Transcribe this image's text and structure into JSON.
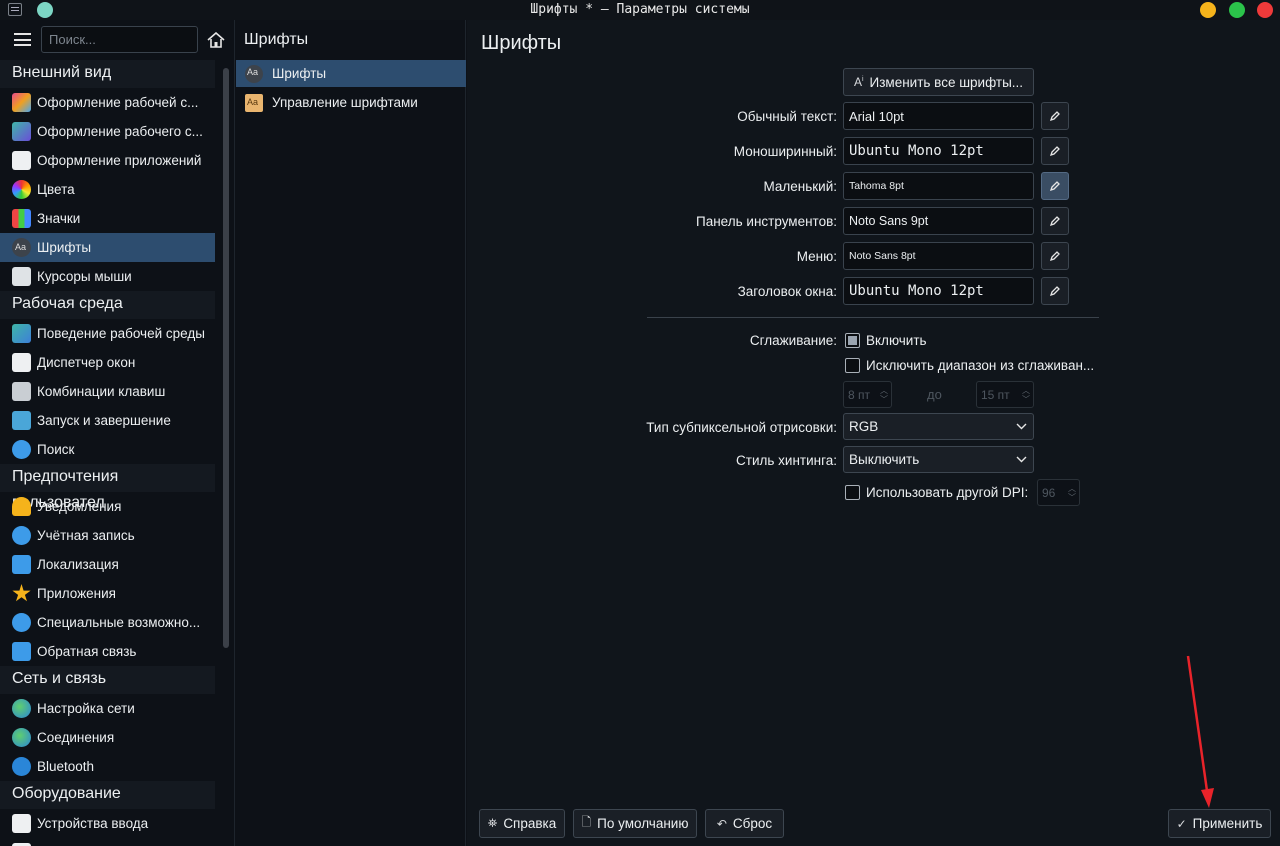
{
  "window": {
    "title": "Шрифты * — Параметры системы"
  },
  "sidebar": {
    "search_placeholder": "Поиск...",
    "categories": [
      {
        "header": "Внешний вид",
        "items": [
          {
            "label": "Оформление рабочей с...",
            "icon": "global-theme-icon"
          },
          {
            "label": "Оформление рабочего с...",
            "icon": "plasma-style-icon"
          },
          {
            "label": "Оформление приложений",
            "icon": "app-style-icon"
          },
          {
            "label": "Цвета",
            "icon": "colors-icon"
          },
          {
            "label": "Значки",
            "icon": "icons-icon"
          },
          {
            "label": "Шрифты",
            "icon": "fonts-icon",
            "active": true
          },
          {
            "label": "Курсоры мыши",
            "icon": "cursor-icon"
          }
        ]
      },
      {
        "header": "Рабочая среда",
        "items": [
          {
            "label": "Поведение рабочей среды",
            "icon": "workspace-icon"
          },
          {
            "label": "Диспетчер окон",
            "icon": "window-manager-icon"
          },
          {
            "label": "Комбинации клавиш",
            "icon": "keyboard-icon"
          },
          {
            "label": "Запуск и завершение",
            "icon": "startup-icon"
          },
          {
            "label": "Поиск",
            "icon": "search-icon"
          }
        ]
      },
      {
        "header": "Предпочтения пользовател",
        "items": [
          {
            "label": "Уведомления",
            "icon": "bell-icon"
          },
          {
            "label": "Учётная запись",
            "icon": "user-icon"
          },
          {
            "label": "Локализация",
            "icon": "locale-icon"
          },
          {
            "label": "Приложения",
            "icon": "star-icon"
          },
          {
            "label": "Специальные возможно...",
            "icon": "accessibility-icon"
          },
          {
            "label": "Обратная связь",
            "icon": "feedback-icon"
          }
        ]
      },
      {
        "header": "Сеть и связь",
        "items": [
          {
            "label": "Настройка сети",
            "icon": "globe-icon"
          },
          {
            "label": "Соединения",
            "icon": "globe-icon"
          },
          {
            "label": "Bluetooth",
            "icon": "bluetooth-icon"
          }
        ]
      },
      {
        "header": "Оборудование",
        "items": [
          {
            "label": "Устройства ввода",
            "icon": "input-devices-icon"
          },
          {
            "label": "Экран",
            "icon": "display-icon"
          }
        ]
      }
    ]
  },
  "middle": {
    "title": "Шрифты",
    "items": [
      {
        "label": "Шрифты",
        "active": true
      },
      {
        "label": "Управление шрифтами",
        "active": false
      }
    ]
  },
  "main": {
    "title": "Шрифты",
    "adjust_all_label": "Изменить все шрифты...",
    "font_rows": [
      {
        "label": "Обычный текст:",
        "value": "Arial 10pt"
      },
      {
        "label": "Моноширинный:",
        "value": "Ubuntu Mono 12pt"
      },
      {
        "label": "Маленький:",
        "value": "Tahoma 8pt"
      },
      {
        "label": "Панель инструментов:",
        "value": "Noto Sans 9pt"
      },
      {
        "label": "Меню:",
        "value": "Noto Sans 8pt"
      },
      {
        "label": "Заголовок окна:",
        "value": "Ubuntu Mono 12pt"
      }
    ],
    "antialias_label": "Сглаживание:",
    "antialias_enable": "Включить",
    "exclude_range": "Исключить диапазон из сглаживан...",
    "range_from": "8 пт",
    "range_to_label": "до",
    "range_to": "15 пт",
    "subpixel_label": "Тип субпиксельной отрисовки:",
    "subpixel_value": "RGB",
    "hinting_label": "Стиль хинтинга:",
    "hinting_value": "Выключить",
    "dpi_label": "Использовать другой DPI:",
    "dpi_value": "96"
  },
  "footer": {
    "help": "Справка",
    "defaults": "По умолчанию",
    "reset": "Сброс",
    "apply": "Применить"
  },
  "colors": {
    "accent": "#2d4d6f",
    "annotation_arrow": "#e8232a"
  }
}
